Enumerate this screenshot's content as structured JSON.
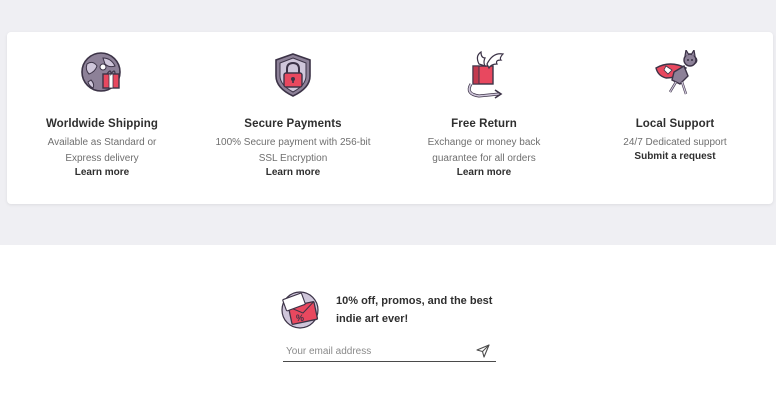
{
  "features": [
    {
      "icon": "globe-gift-icon",
      "title": "Worldwide Shipping",
      "desc": "Available as Standard or Express delivery",
      "link": "Learn more"
    },
    {
      "icon": "shield-lock-icon",
      "title": "Secure Payments",
      "desc": "100% Secure payment with 256-bit SSL Encryption",
      "link": "Learn more"
    },
    {
      "icon": "winged-box-return-icon",
      "title": "Free Return",
      "desc": "Exchange or money back guarantee for all orders",
      "link": "Learn more"
    },
    {
      "icon": "superhero-cat-icon",
      "title": "Local Support",
      "desc": "24/7 Dedicated support",
      "link": "Submit a request"
    }
  ],
  "newsletter": {
    "icon": "discount-envelope-icon",
    "promo": "10% off, promos, and the best indie art ever!",
    "email_placeholder": "Your email address",
    "send_icon": "paper-plane-icon"
  },
  "colors": {
    "accent_red": "#e8485f",
    "icon_purple": "#5b4e6e",
    "icon_lavender": "#cfc6da",
    "band_bg": "#efeff3"
  }
}
